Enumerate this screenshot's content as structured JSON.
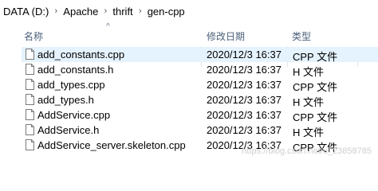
{
  "breadcrumb": [
    "DATA (D:)",
    "Apache",
    "thrift",
    "gen-cpp"
  ],
  "columns": {
    "name": "名称",
    "date": "修改日期",
    "type": "类型"
  },
  "files": [
    {
      "name": "add_constants.cpp",
      "date": "2020/12/3 16:37",
      "type": "CPP 文件",
      "selected": true
    },
    {
      "name": "add_constants.h",
      "date": "2020/12/3 16:37",
      "type": "H 文件"
    },
    {
      "name": "add_types.cpp",
      "date": "2020/12/3 16:37",
      "type": "CPP 文件"
    },
    {
      "name": "add_types.h",
      "date": "2020/12/3 16:37",
      "type": "H 文件"
    },
    {
      "name": "AddService.cpp",
      "date": "2020/12/3 16:37",
      "type": "CPP 文件"
    },
    {
      "name": "AddService.h",
      "date": "2020/12/3 16:37",
      "type": "H 文件"
    },
    {
      "name": "AddService_server.skeleton.cpp",
      "date": "2020/12/3 16:37",
      "type": "CPP 文件"
    }
  ],
  "watermark": "https://blog.csdn.net/u_23858785"
}
